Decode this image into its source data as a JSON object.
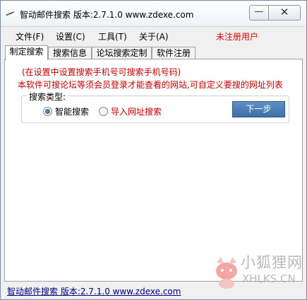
{
  "window": {
    "title": "智动邮件搜索 版本:2.7.1.0 www.zdexe.com",
    "minimize_glyph": "—",
    "close_glyph": "✕"
  },
  "menu": {
    "items": [
      "文件(F)",
      "设置(C)",
      "工具(T)",
      "关于(A)"
    ],
    "status": "未注册用户"
  },
  "tabs": [
    "制定搜索",
    "搜索信息",
    "论坛搜索定制",
    "软件注册"
  ],
  "active_tab": 0,
  "main": {
    "hint_phone": "(在设置中设置搜索手机号可搜索手机号码)",
    "hint_forum": "本软件可搜论坛等须会员登录才能查看的网站,可自定义要搜的网址列表",
    "search_type": {
      "legend": "搜索类型:",
      "options": [
        {
          "label": "智能搜索",
          "checked": true
        },
        {
          "label": "导入网址搜索",
          "checked": false
        }
      ],
      "next_button": "下一步"
    }
  },
  "statusbar": {
    "text": "智动邮件搜索 版本:2.7.1.0 www.zdexe.com"
  },
  "watermark": {
    "cn": "小狐狸网",
    "en": "XHLKS.CN"
  },
  "colors": {
    "accent_red": "#e00000",
    "hint_red": "#c00000",
    "button_blue": "#4a7cb5",
    "link_navy": "#000080"
  }
}
